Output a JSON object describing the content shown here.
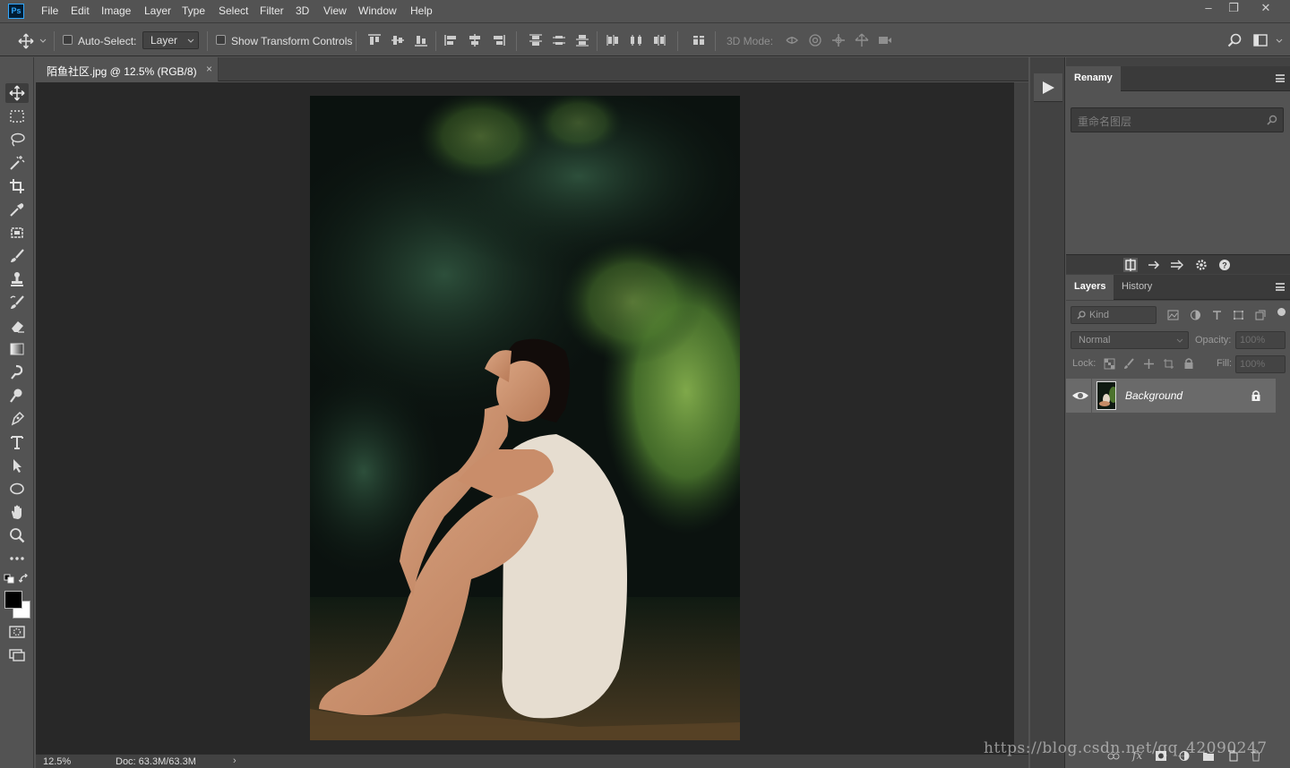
{
  "app": {
    "logo_text": "Ps"
  },
  "menu": [
    "File",
    "Edit",
    "Image",
    "Layer",
    "Type",
    "Select",
    "Filter",
    "3D",
    "View",
    "Window",
    "Help"
  ],
  "window_controls": {
    "minimize": "–",
    "restore": "❐",
    "close": "✕"
  },
  "options_bar": {
    "auto_select_label": "Auto-Select:",
    "auto_select_checked": false,
    "auto_select_target": "Layer",
    "show_transform_label": "Show Transform Controls",
    "show_transform_checked": false,
    "mode_3d_label": "3D Mode:"
  },
  "document": {
    "tab_title": "陌鱼社区.jpg @ 12.5% (RGB/8)",
    "tab_close": "×",
    "zoom": "12.5%",
    "doc_size": "Doc: 63.3M/63.3M",
    "status_arrow": "›"
  },
  "toolbar": {
    "tools": [
      "move-tool",
      "marquee-tool",
      "lasso-tool",
      "magic-wand-tool",
      "crop-tool",
      "eyedropper-tool",
      "healing-tool",
      "brush-tool",
      "stamp-tool",
      "history-brush-tool",
      "eraser-tool",
      "gradient-tool",
      "blur-tool",
      "dodge-tool",
      "pen-tool",
      "type-tool",
      "path-select-tool",
      "ellipse-tool",
      "hand-tool",
      "zoom-tool",
      "more-tools"
    ],
    "active_tool": "move-tool",
    "foreground_color": "#000000",
    "background_color": "#ffffff"
  },
  "renamy_panel": {
    "tab": "Renamy",
    "search_placeholder": "重命名图层"
  },
  "layers_panel": {
    "tabs": [
      "Layers",
      "History"
    ],
    "active_tab": "Layers",
    "filter_label": "Kind",
    "blend_mode": "Normal",
    "opacity_label": "Opacity:",
    "opacity_value": "100%",
    "lock_label": "Lock:",
    "fill_label": "Fill:",
    "fill_value": "100%",
    "layers": [
      {
        "name": "Background",
        "visible": true,
        "locked": true
      }
    ]
  },
  "watermark": "https://blog.csdn.net/qq_42090247"
}
